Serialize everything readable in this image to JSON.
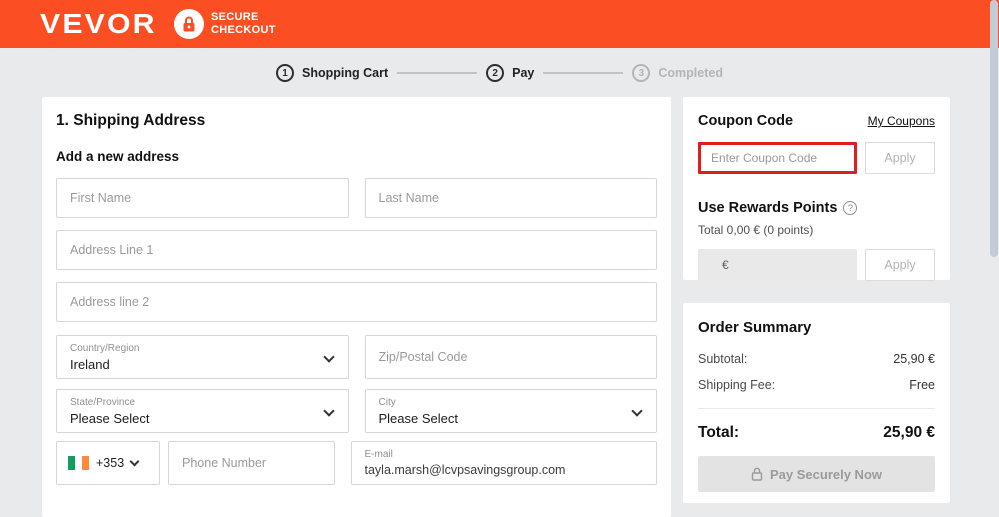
{
  "header": {
    "logo": "VEVOR",
    "secure_line1": "SECURE",
    "secure_line2": "CHECKOUT"
  },
  "steps": [
    {
      "number": "1",
      "label": "Shopping Cart"
    },
    {
      "number": "2",
      "label": "Pay"
    },
    {
      "number": "3",
      "label": "Completed"
    }
  ],
  "shipping": {
    "title": "1. Shipping Address",
    "subtitle": "Add a new address",
    "first_name_placeholder": "First Name",
    "last_name_placeholder": "Last Name",
    "address1_placeholder": "Address Line 1",
    "address2_placeholder": "Address line 2",
    "country_label": "Country/Region",
    "country_value": "Ireland",
    "zip_placeholder": "Zip/Postal Code",
    "state_label": "State/Province",
    "state_value": "Please Select",
    "city_label": "City",
    "city_value": "Please Select",
    "phone_prefix": "+353",
    "phone_placeholder": "Phone Number",
    "email_label": "E-mail",
    "email_value": "tayla.marsh@lcvpsavingsgroup.com"
  },
  "coupon": {
    "title": "Coupon Code",
    "link": "My Coupons",
    "input_placeholder": "Enter Coupon Code",
    "apply_label": "Apply"
  },
  "rewards": {
    "title": "Use Rewards Points",
    "help": "?",
    "total_text": "Total 0,00 € (0 points)",
    "input_value": "€",
    "apply_label": "Apply"
  },
  "order_summary": {
    "title": "Order Summary",
    "rows": [
      {
        "label": "Subtotal:",
        "value": "25,90 €"
      },
      {
        "label": "Shipping Fee:",
        "value": "Free"
      }
    ],
    "total_label": "Total:",
    "total_value": "25,90 €",
    "pay_button": "Pay Securely Now"
  },
  "colors": {
    "accent_orange": "#fb4e23",
    "highlight_red": "#e01e1e",
    "page_bg": "#e9eaec",
    "flag_green": "#169b62",
    "flag_orange": "#ff883e"
  }
}
